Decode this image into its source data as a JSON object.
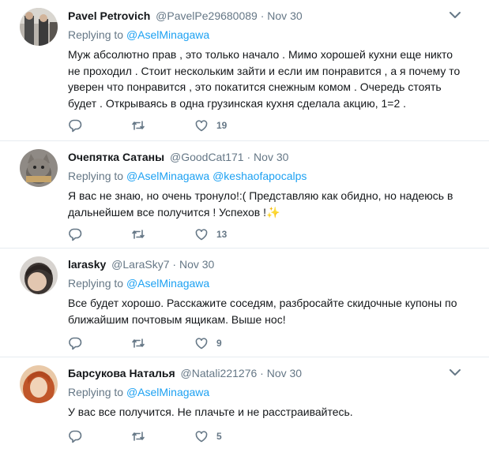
{
  "tweets": [
    {
      "name": "Pavel Petrovich",
      "handle": "@PavelPe29680089",
      "separator": "·",
      "time": "Nov 30",
      "replying_prefix": "Replying to",
      "mentions": [
        "@AselMinagawa"
      ],
      "text_lines": [
        "Муж абсолютно прав , это только начало . Мимо хорошей кухни еще никто",
        "не проходил . Стоит нескольким зайти и если им понравится , а я почему то",
        "уверен что понравится , это покатится снежным комом . Очередь стоять",
        "будет . Открываясь в одна грузинская кухня сделала акцию, 1=2 ."
      ],
      "like_count": "19",
      "has_caret": true
    },
    {
      "name": "Очепятка Сатаны",
      "handle": "@GoodCat171",
      "separator": "·",
      "time": "Nov 30",
      "replying_prefix": "Replying to",
      "mentions": [
        "@AselMinagawa",
        "@keshaofapocalps"
      ],
      "text_lines": [
        "Я вас не знаю, но очень тронуло!:( Представляю как обидно, но надеюсь в",
        "дальнейшем все получится ! Успехов !✨"
      ],
      "like_count": "13",
      "has_caret": false
    },
    {
      "name": "larasky",
      "handle": "@LaraSky7",
      "separator": "·",
      "time": "Nov 30",
      "replying_prefix": "Replying to",
      "mentions": [
        "@AselMinagawa"
      ],
      "text_lines": [
        "Все будет хорошо. Расскажите соседям, разбросайте скидочные купоны по",
        "ближайшим почтовым ящикам. Выше нос!"
      ],
      "like_count": "9",
      "has_caret": false
    },
    {
      "name": "Барсукова Наталья",
      "handle": "@Natali221276",
      "separator": "·",
      "time": "Nov 30",
      "replying_prefix": "Replying to",
      "mentions": [
        "@AselMinagawa"
      ],
      "text_lines": [
        "У вас все получится. Не плачьте и не расстраивайтесь."
      ],
      "like_count": "5",
      "has_caret": true
    }
  ],
  "icons": {
    "reply": "reply-icon",
    "retweet": "retweet-icon",
    "like": "like-icon",
    "caret": "chevron-down-icon"
  },
  "colors": {
    "text": "#14171a",
    "secondary": "#657786",
    "link": "#1da1f2",
    "border": "#e6ecf0"
  }
}
